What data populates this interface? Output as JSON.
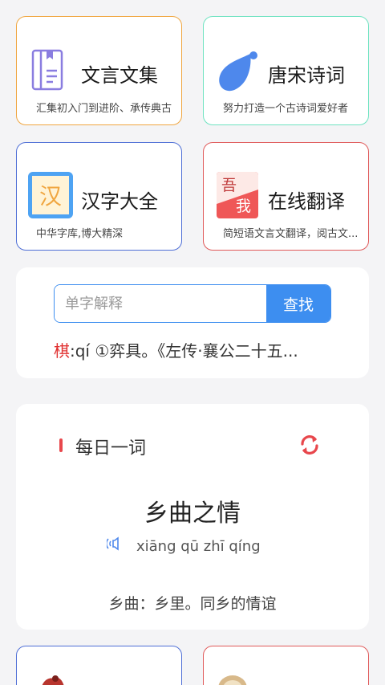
{
  "features": [
    {
      "title": "文言文集",
      "subtitle": "汇集初入门到进阶、承传典古",
      "border_color": "#f0a640",
      "icon": "book-icon"
    },
    {
      "title": "唐宋诗词",
      "subtitle": "努力打造一个古诗词爱好者",
      "border_color": "#6fe3c1",
      "icon": "leaf-icon"
    },
    {
      "title": "汉字大全",
      "subtitle": "中华字库,博大精深",
      "border_color": "#4f6fd6",
      "icon": "han-char-icon",
      "icon_text": "汉"
    },
    {
      "title": "在线翻译",
      "subtitle": "简短语文言文翻译，阅古文...",
      "border_color": "#e05a5a",
      "icon": "translate-icon",
      "icon_text": [
        "吾",
        "我"
      ]
    }
  ],
  "search": {
    "placeholder": "单字解释",
    "button_label": "查找"
  },
  "definition": {
    "char": "棋",
    "text": ":qí ①弈具。《左传·襄公二十五..."
  },
  "daily_word": {
    "label": "每日一词",
    "word": "乡曲之情",
    "pinyin": "xiāng qū zhī qíng",
    "meaning": "乡曲：乡里。同乡的情谊",
    "accent_color": "#e8474c"
  },
  "bottom_cards": [
    {
      "border_color": "#4f6fd6",
      "icon": "figure-icon"
    },
    {
      "border_color": "#e05a5a",
      "icon": "portrait-icon"
    }
  ]
}
